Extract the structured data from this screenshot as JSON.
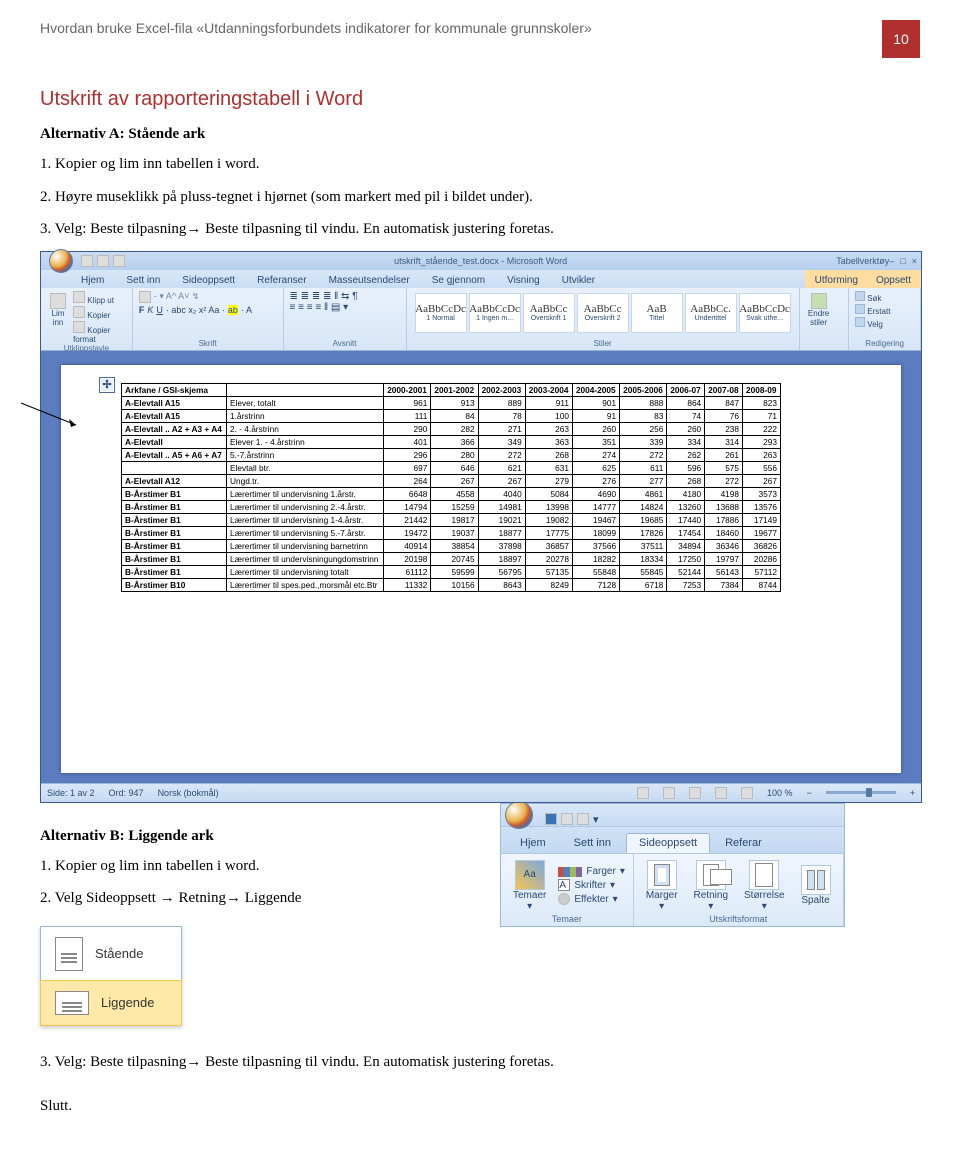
{
  "header": {
    "running_head": "Hvordan bruke Excel-fila «Utdanningsforbundets indikatorer for kommunale grunnskoler»",
    "page_number": "10"
  },
  "section_title": "Utskrift av rapporteringstabell i Word",
  "alt_a": {
    "heading": "Alternativ A: Stående ark",
    "step1": "1. Kopier og lim inn tabellen i word.",
    "step2": "2. Høyre museklikk på pluss-tegnet i hjørnet (som markert med pil i bildet under).",
    "step3_pre": "3. Velg: Beste tilpasning",
    "step3_mid": " Beste tilpasning til vindu. En automatisk justering foretas.",
    "arrow": "→"
  },
  "alt_b": {
    "heading": "Alternativ B: Liggende ark",
    "step1": "1. Kopier og lim inn tabellen i word.",
    "step2_pre": "2. Velg Sideoppsett ",
    "step2_mid": " Retning",
    "step2_end": " Liggende",
    "step3_pre": "3. Velg: Beste tilpasning",
    "step3_mid": " Beste tilpasning til vindu. En automatisk justering foretas.",
    "arrow": "→"
  },
  "slutt": "Slutt.",
  "orient_menu": {
    "portrait": "Stående",
    "landscape": "Liggende"
  },
  "word_screenshot": {
    "title_doc": "utskrift_stående_test.docx - Microsoft Word",
    "context_tool": "Tabellverktøy",
    "tabs": [
      "Hjem",
      "Sett inn",
      "Sideoppsett",
      "Referanser",
      "Masseutsendelser",
      "Se gjennom",
      "Visning",
      "Utvikler"
    ],
    "context_tabs": [
      "Utforming",
      "Oppsett"
    ],
    "clipboard": {
      "paste": "Lim inn",
      "cut": "Klipp ut",
      "copy": "Kopier",
      "format": "Kopier format",
      "group": "Utklippstavle"
    },
    "font_group": "Skrift",
    "para_group": "Avsnitt",
    "style_names": [
      "1 Normal",
      "1 Ingen m...",
      "Overskrift 1",
      "Overskrift 2",
      "Tittel",
      "Undertittel",
      "Svak uthe..."
    ],
    "style_preview_text": [
      "AaBbCcDc",
      "AaBbCcDc",
      "AaBbCc",
      "AaBbCc",
      "AaB",
      "AaBbCc.",
      "AaBbCcDc"
    ],
    "styles_group": "Stiler",
    "change_styles": "Endre stiler",
    "editing": {
      "find": "Søk",
      "replace": "Erstatt",
      "select": "Velg",
      "group": "Redigering"
    },
    "status": {
      "page": "Side: 1 av 2",
      "words": "Ord: 947",
      "lang": "Norsk (bokmål)",
      "zoom": "100 %"
    },
    "table": {
      "headers": [
        "Arkfane / GSI-skjema",
        "",
        "2000-2001",
        "2001-2002",
        "2002-2003",
        "2003-2004",
        "2004-2005",
        "2005-2006",
        "2006-07",
        "2007-08",
        "2008-09"
      ],
      "rows": [
        {
          "k": "A-Elevtall A15",
          "d": "Elever, totalt",
          "v": [
            "961",
            "913",
            "889",
            "911",
            "901",
            "888",
            "864",
            "847",
            "823"
          ]
        },
        {
          "k": "A-Elevtall A15",
          "d": "1.årstrinn",
          "v": [
            "111",
            "84",
            "78",
            "100",
            "91",
            "83",
            "74",
            "76",
            "71"
          ]
        },
        {
          "k": "A-Elevtall .. A2 + A3 + A4",
          "d": "2. - 4.årstrinn",
          "v": [
            "290",
            "282",
            "271",
            "263",
            "260",
            "256",
            "260",
            "238",
            "222"
          ]
        },
        {
          "k": "A-Elevtall",
          "d": "Elever 1. - 4.årstrinn",
          "v": [
            "401",
            "366",
            "349",
            "363",
            "351",
            "339",
            "334",
            "314",
            "293"
          ]
        },
        {
          "k": "A-Elevtall .. A5 + A6 + A7",
          "d": "5.-7.årstrinn",
          "v": [
            "296",
            "280",
            "272",
            "268",
            "274",
            "272",
            "262",
            "261",
            "263"
          ]
        },
        {
          "k": "",
          "d": "Elevtall btr.",
          "v": [
            "697",
            "646",
            "621",
            "631",
            "625",
            "611",
            "596",
            "575",
            "556"
          ]
        },
        {
          "k": "A-Elevtall A12",
          "d": "Ungd.tr.",
          "v": [
            "264",
            "267",
            "267",
            "279",
            "276",
            "277",
            "268",
            "272",
            "267"
          ]
        },
        {
          "k": "B-Årstimer B1",
          "d": "Lærertimer til undervisning 1.årstr.",
          "v": [
            "6648",
            "4558",
            "4040",
            "5084",
            "4690",
            "4861",
            "4180",
            "4198",
            "3573"
          ]
        },
        {
          "k": "B-Årstimer B1",
          "d": "Lærertimer til undervisning 2.-4.årstr.",
          "v": [
            "14794",
            "15259",
            "14981",
            "13998",
            "14777",
            "14824",
            "13260",
            "13688",
            "13576"
          ]
        },
        {
          "k": "B-Årstimer B1",
          "d": "Lærertimer til undervisning 1-4.årstr.",
          "v": [
            "21442",
            "19817",
            "19021",
            "19082",
            "19467",
            "19685",
            "17440",
            "17886",
            "17149"
          ]
        },
        {
          "k": "B-Årstimer B1",
          "d": "Lærertimer til undervisning 5.-7.årstr.",
          "v": [
            "19472",
            "19037",
            "18877",
            "17775",
            "18099",
            "17826",
            "17454",
            "18460",
            "19677"
          ]
        },
        {
          "k": "B-Årstimer B1",
          "d": "Lærertimer til undervisning barnetrinn",
          "v": [
            "40914",
            "38854",
            "37898",
            "36857",
            "37566",
            "37511",
            "34894",
            "36346",
            "36826"
          ]
        },
        {
          "k": "B-Årstimer B1",
          "d": "Lærertimer til undervisningungdomstrinn",
          "v": [
            "20198",
            "20745",
            "18897",
            "20278",
            "18282",
            "18334",
            "17250",
            "19797",
            "20286"
          ]
        },
        {
          "k": "B-Årstimer B1",
          "d": "Lærertimer til undervisning totalt",
          "v": [
            "61112",
            "59599",
            "56795",
            "57135",
            "55848",
            "55845",
            "52144",
            "56143",
            "57112"
          ]
        },
        {
          "k": "B-Årstimer B10",
          "d": "Lærertimer til spes.ped.,morsmål etc.Btr",
          "v": [
            "11332",
            "10156",
            "8643",
            "8249",
            "7128",
            "6718",
            "7253",
            "7384",
            "8744"
          ]
        }
      ]
    }
  },
  "ribbon_snip": {
    "tabs": [
      "Hjem",
      "Sett inn",
      "Sideoppsett",
      "Referar"
    ],
    "active_tab": "Sideoppsett",
    "themes": {
      "btn": "Temaer",
      "colors": "Farger",
      "fonts": "Skrifter",
      "effects": "Effekter",
      "group": "Temaer"
    },
    "page_setup": {
      "margins": "Marger",
      "orientation": "Retning",
      "size": "Størrelse",
      "columns": "Spalte",
      "group": "Utskriftsformat"
    }
  }
}
